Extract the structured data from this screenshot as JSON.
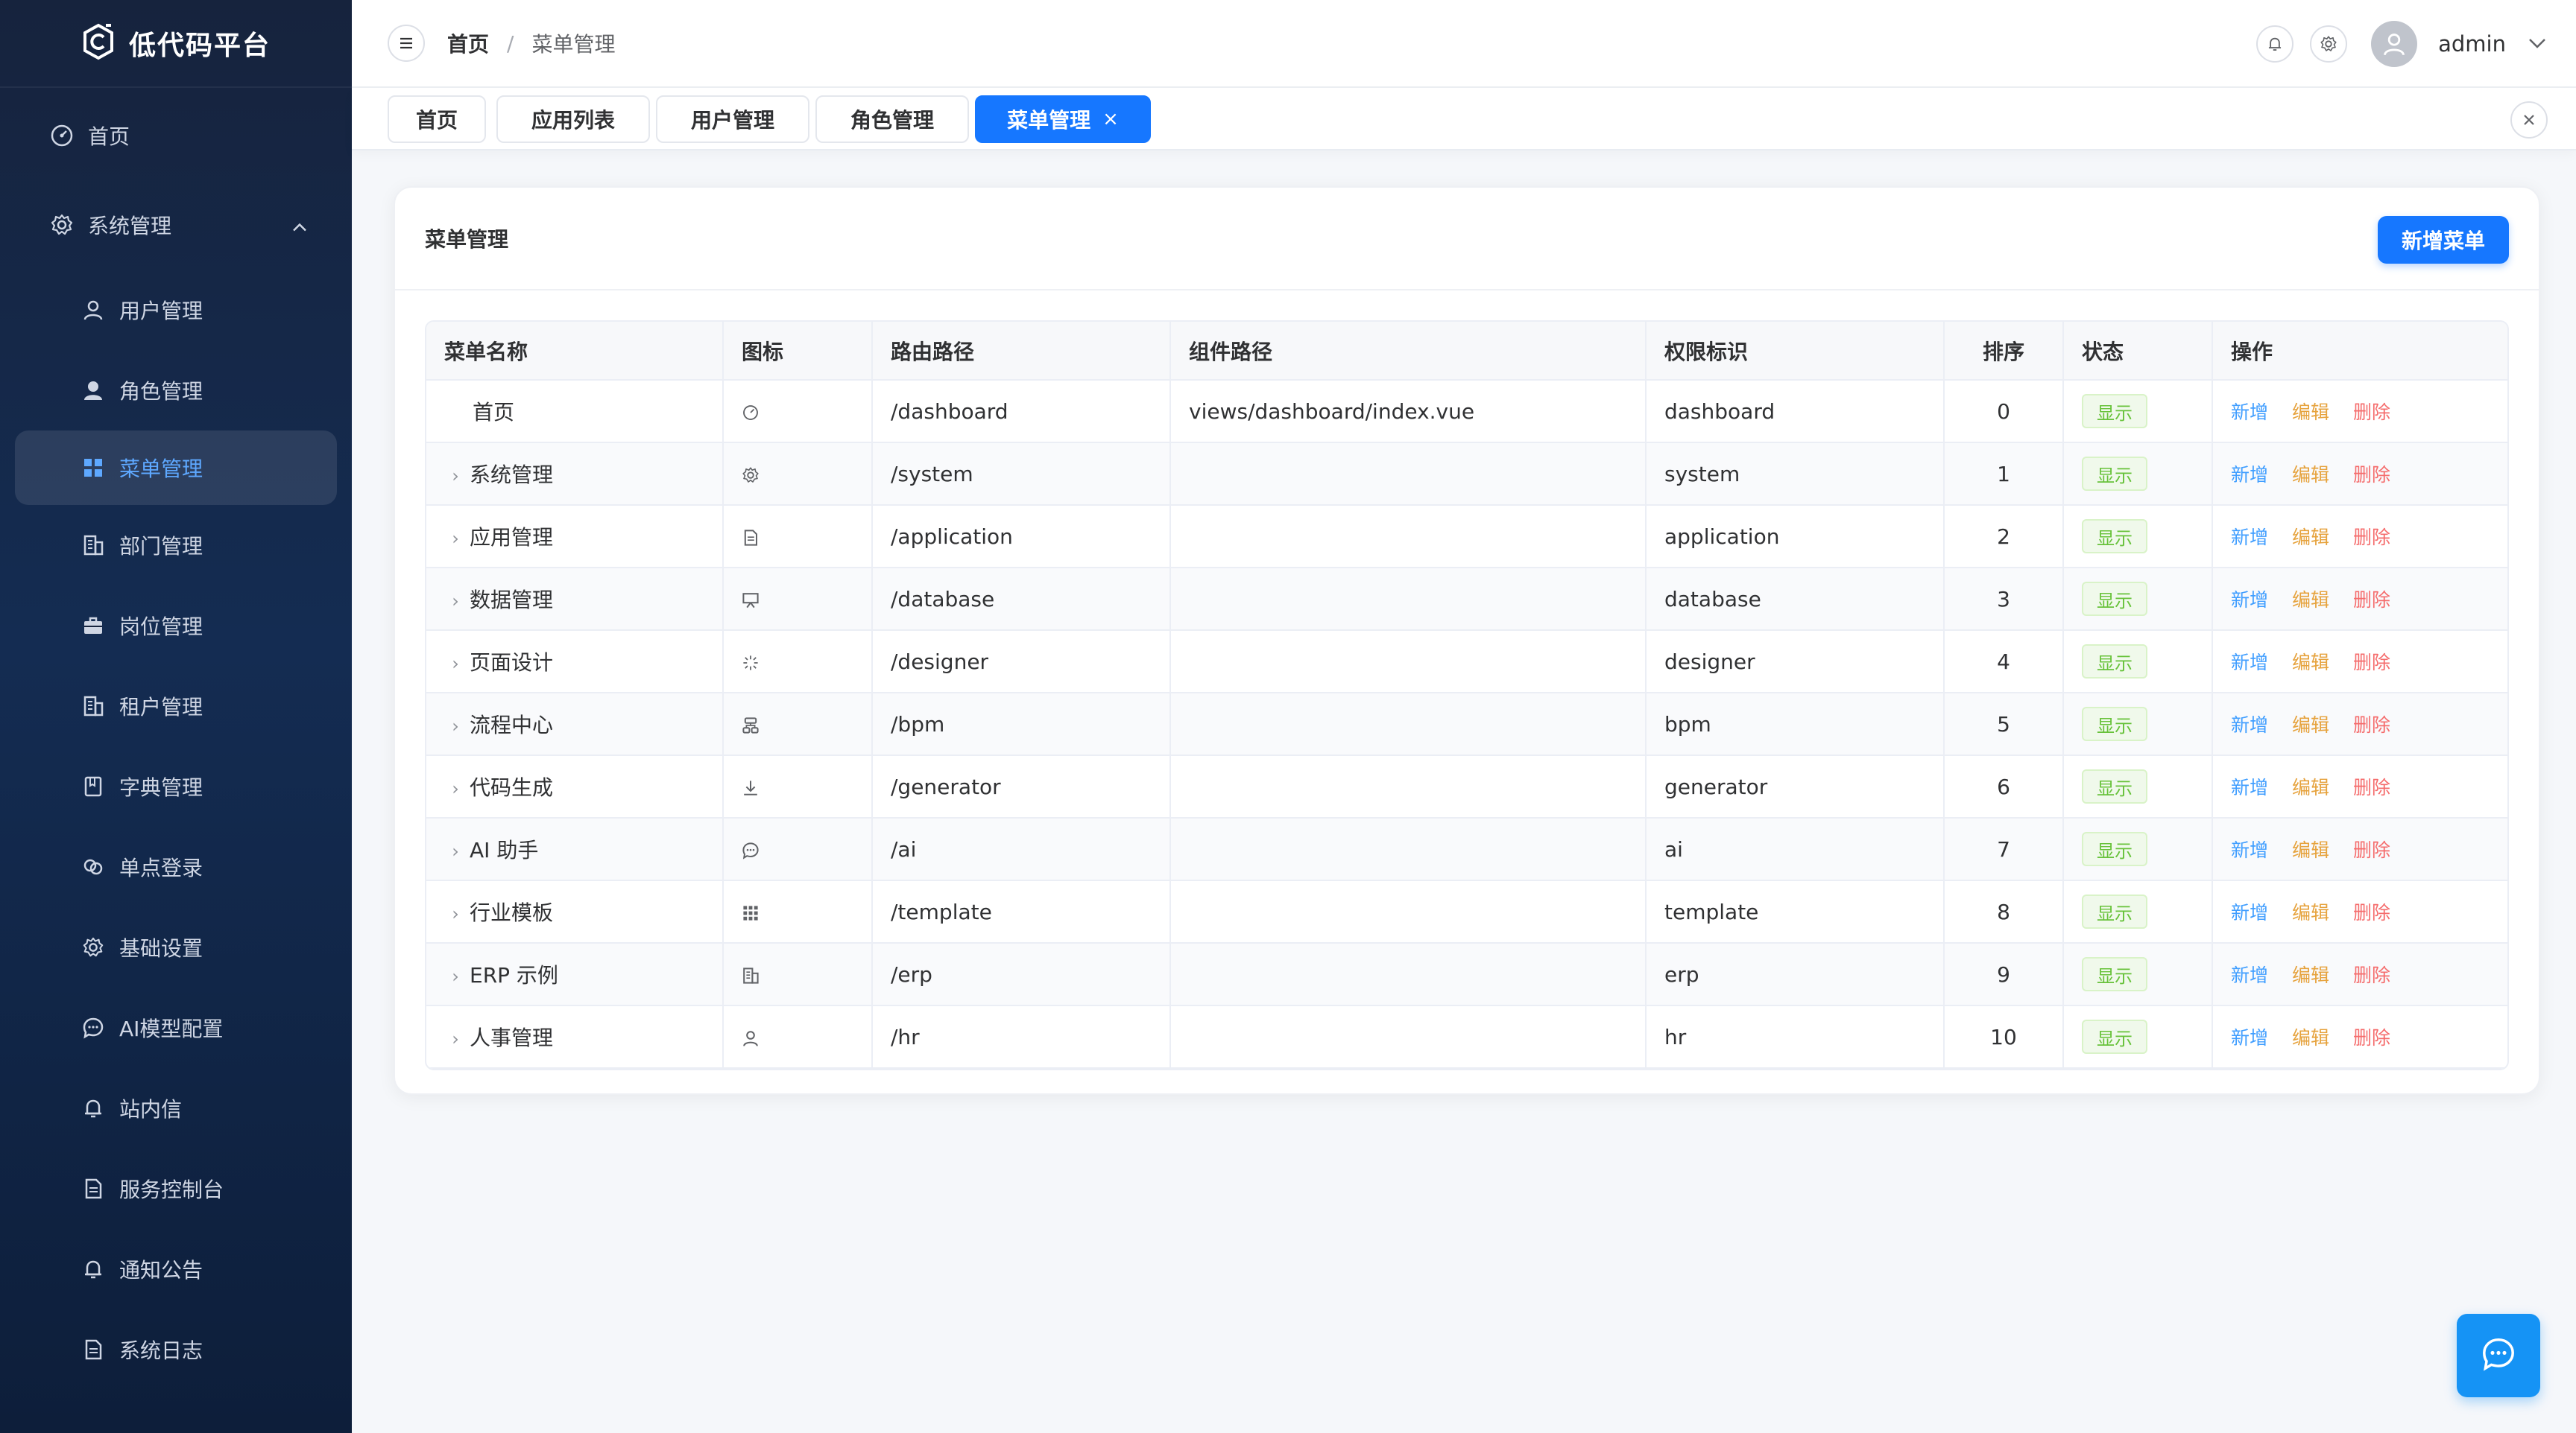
{
  "app": {
    "title": "低代码平台"
  },
  "sidebar": {
    "items": [
      {
        "label": "首页",
        "icon": "dashboard-icon",
        "level": "top"
      },
      {
        "label": "系统管理",
        "icon": "gear-icon",
        "level": "top",
        "expanded": true
      },
      {
        "label": "用户管理",
        "icon": "user-icon",
        "level": "sub"
      },
      {
        "label": "角色管理",
        "icon": "user-filled-icon",
        "level": "sub"
      },
      {
        "label": "菜单管理",
        "icon": "grid-icon",
        "level": "sub",
        "active": true
      },
      {
        "label": "部门管理",
        "icon": "office-building-icon",
        "level": "sub"
      },
      {
        "label": "岗位管理",
        "icon": "briefcase-icon",
        "level": "sub"
      },
      {
        "label": "租户管理",
        "icon": "office-building-icon",
        "level": "sub"
      },
      {
        "label": "字典管理",
        "icon": "notebook-icon",
        "level": "sub"
      },
      {
        "label": "单点登录",
        "icon": "link-icon",
        "level": "sub"
      },
      {
        "label": "基础设置",
        "icon": "gear-icon",
        "level": "sub"
      },
      {
        "label": "AI模型配置",
        "icon": "chat-icon",
        "level": "sub"
      },
      {
        "label": "站内信",
        "icon": "bell-icon",
        "level": "sub"
      },
      {
        "label": "服务控制台",
        "icon": "document-icon",
        "level": "sub"
      },
      {
        "label": "通知公告",
        "icon": "bell-icon",
        "level": "sub"
      },
      {
        "label": "系统日志",
        "icon": "document-icon",
        "level": "sub"
      }
    ]
  },
  "header": {
    "breadcrumb": {
      "home": "首页",
      "separator": "/",
      "current": "菜单管理"
    },
    "username": "admin"
  },
  "tabs": [
    {
      "label": "首页"
    },
    {
      "label": "应用列表"
    },
    {
      "label": "用户管理"
    },
    {
      "label": "角色管理"
    },
    {
      "label": "菜单管理",
      "active": true,
      "close": "×"
    }
  ],
  "card": {
    "title": "菜单管理",
    "add_button": "新增菜单"
  },
  "table": {
    "columns": [
      "菜单名称",
      "图标",
      "路由路径",
      "组件路径",
      "权限标识",
      "排序",
      "状态",
      "操作"
    ],
    "rows": [
      {
        "name": "首页",
        "icon": "dashboard-icon",
        "route": "/dashboard",
        "component": "views/dashboard/index.vue",
        "perm": "dashboard",
        "sort": "0",
        "status": "显示",
        "expandable": false
      },
      {
        "name": "系统管理",
        "icon": "gear-icon",
        "route": "/system",
        "component": "",
        "perm": "system",
        "sort": "1",
        "status": "显示",
        "expandable": true
      },
      {
        "name": "应用管理",
        "icon": "document-icon",
        "route": "/application",
        "component": "",
        "perm": "application",
        "sort": "2",
        "status": "显示",
        "expandable": true
      },
      {
        "name": "数据管理",
        "icon": "presentation-icon",
        "route": "/database",
        "component": "",
        "perm": "database",
        "sort": "3",
        "status": "显示",
        "expandable": true
      },
      {
        "name": "页面设计",
        "icon": "magic-stick-icon",
        "route": "/designer",
        "component": "",
        "perm": "designer",
        "sort": "4",
        "status": "显示",
        "expandable": true
      },
      {
        "name": "流程中心",
        "icon": "flow-icon",
        "route": "/bpm",
        "component": "",
        "perm": "bpm",
        "sort": "5",
        "status": "显示",
        "expandable": true
      },
      {
        "name": "代码生成",
        "icon": "download-icon",
        "route": "/generator",
        "component": "",
        "perm": "generator",
        "sort": "6",
        "status": "显示",
        "expandable": true
      },
      {
        "name": "AI 助手",
        "icon": "chat-icon",
        "route": "/ai",
        "component": "",
        "perm": "ai",
        "sort": "7",
        "status": "显示",
        "expandable": true
      },
      {
        "name": "行业模板",
        "icon": "grid-dots-icon",
        "route": "/template",
        "component": "",
        "perm": "template",
        "sort": "8",
        "status": "显示",
        "expandable": true
      },
      {
        "name": "ERP 示例",
        "icon": "office-building-icon",
        "route": "/erp",
        "component": "",
        "perm": "erp",
        "sort": "9",
        "status": "显示",
        "expandable": true
      },
      {
        "name": "人事管理",
        "icon": "user-icon",
        "route": "/hr",
        "component": "",
        "perm": "hr",
        "sort": "10",
        "status": "显示",
        "expandable": true
      }
    ],
    "actions": {
      "add": "新增",
      "edit": "编辑",
      "delete": "删除"
    }
  },
  "colors": {
    "primary": "#1677ff",
    "success": "#67c23a",
    "warning": "#e6a23c",
    "danger": "#f56c6c",
    "sidebar": "#16233d"
  }
}
